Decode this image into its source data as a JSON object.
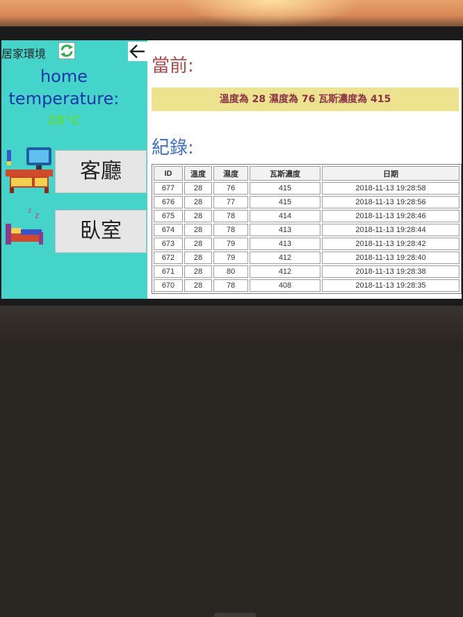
{
  "app": {
    "title": "居家環境",
    "home_label": "home",
    "temperature_label": "temperature:",
    "temperature_value": "28°C"
  },
  "icons": {
    "refresh": "refresh-icon",
    "back": "arrow-left-icon",
    "living_room": "living-room-icon",
    "bedroom": "bedroom-icon"
  },
  "rooms": {
    "living_room": "客廳",
    "bedroom": "臥室"
  },
  "current": {
    "title": "當前:",
    "text": "溫度為 28 濕度為 76 瓦斯濃度為 415"
  },
  "records": {
    "title": "紀錄:",
    "headers": [
      "ID",
      "溫度",
      "濕度",
      "瓦斯濃度",
      "日期"
    ],
    "rows": [
      [
        "677",
        "28",
        "76",
        "415",
        "2018-11-13 19:28:58"
      ],
      [
        "676",
        "28",
        "77",
        "415",
        "2018-11-13 19:28:56"
      ],
      [
        "675",
        "28",
        "78",
        "414",
        "2018-11-13 19:28:46"
      ],
      [
        "674",
        "28",
        "78",
        "413",
        "2018-11-13 19:28:44"
      ],
      [
        "673",
        "28",
        "79",
        "413",
        "2018-11-13 19:28:42"
      ],
      [
        "672",
        "28",
        "79",
        "412",
        "2018-11-13 19:28:40"
      ],
      [
        "671",
        "28",
        "80",
        "412",
        "2018-11-13 19:28:38"
      ],
      [
        "670",
        "28",
        "78",
        "408",
        "2018-11-13 19:28:35"
      ]
    ]
  },
  "colors": {
    "sidebar": "#44d4c9",
    "current_title": "#b54848",
    "record_title": "#3d6fd8",
    "current_bar": "#ede38e",
    "temperature_value": "#5adb4c"
  }
}
